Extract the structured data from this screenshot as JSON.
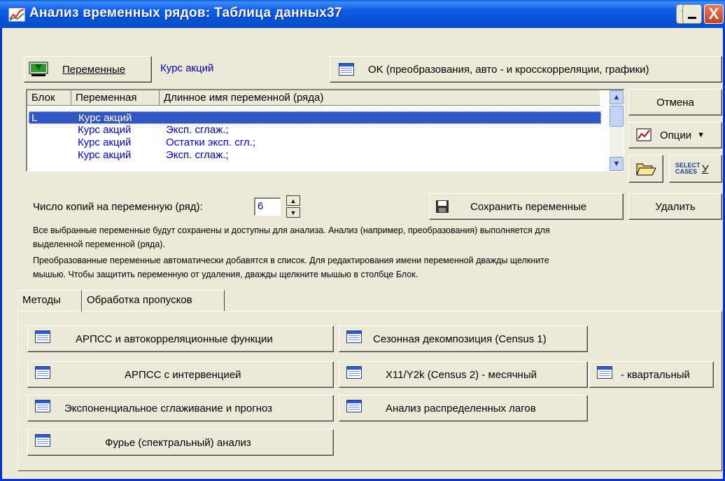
{
  "window": {
    "title": "Анализ временных рядов: Таблица данных37",
    "help_label": "?",
    "minimize_label": "_",
    "close_label": "X"
  },
  "toolbar": {
    "variables_button": "Переменные",
    "variable_value": "Курс акций",
    "ok_button": "OK (преобразования, авто - и кросскорреляции, графики)"
  },
  "list": {
    "columns": [
      "Блок",
      "Переменная",
      "Длинное имя переменной (ряда)"
    ],
    "rows": [
      {
        "block": "L",
        "variable": "Курс акций",
        "long_name": ""
      },
      {
        "block": "",
        "variable": "Курс акций",
        "long_name": "Эксп. сглаж.;"
      },
      {
        "block": "",
        "variable": "Курс акций",
        "long_name": "Остатки эксп. сгл.;"
      },
      {
        "block": "",
        "variable": "Курс акций",
        "long_name": "Эксп. сглаж.;"
      }
    ]
  },
  "side": {
    "cancel_button": "Отмена",
    "options_button": "Опции",
    "select_cases_label": "SELECT CASES",
    "select_cases_key": "У"
  },
  "copies": {
    "label": "Число копий на переменную (ряд):",
    "value": "6"
  },
  "save_button": "Сохранить переменные",
  "delete_button": "Удалить",
  "info": {
    "line1": "Все выбранные переменные будут сохранены и доступны для анализа. Анализ (например, преобразования) выполняется для",
    "line2": "выделенной переменной (ряда).",
    "line3": "Преобразованные переменные автоматически добавятся в список. Для редактирования имени переменной дважды щелкните",
    "line4": "мышью. Чтобы защитить переменную от удаления, дважды щелкните мышью в столбце Блок."
  },
  "tabs": [
    "Методы",
    "Обработка пропусков"
  ],
  "methods": {
    "arima_acf": "АРПСС и автокорреляционные функции",
    "arima_intervention": "АРПСС с интервенцией",
    "exp_smoothing": "Экспоненциальное сглаживание и прогноз",
    "fourier": "Фурье (спектральный) анализ",
    "seasonal_decomp": "Сезонная декомпозиция (Census 1)",
    "x11_monthly": "X11/Y2k (Census 2) - месячный",
    "quarterly": "- квартальный",
    "distributed_lags": "Анализ распределенных лагов"
  }
}
